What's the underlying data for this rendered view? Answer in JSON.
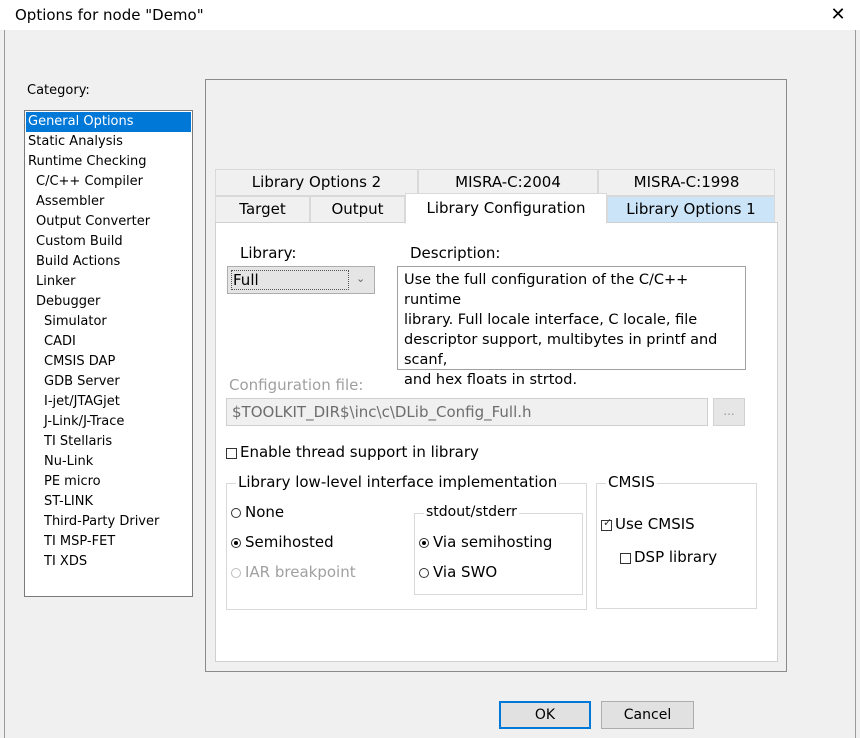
{
  "window": {
    "title": "Options for node \"Demo\""
  },
  "category": {
    "label": "Category:",
    "items": [
      {
        "label": "General Options",
        "selected": true
      },
      {
        "label": "Static Analysis"
      },
      {
        "label": "Runtime Checking"
      },
      {
        "label": "C/C++ Compiler"
      },
      {
        "label": "Assembler"
      },
      {
        "label": "Output Converter"
      },
      {
        "label": "Custom Build"
      },
      {
        "label": "Build Actions"
      },
      {
        "label": "Linker"
      },
      {
        "label": "Debugger"
      },
      {
        "label": "Simulator"
      },
      {
        "label": "CADI"
      },
      {
        "label": "CMSIS DAP"
      },
      {
        "label": "GDB Server"
      },
      {
        "label": "I-jet/JTAGjet"
      },
      {
        "label": "J-Link/J-Trace"
      },
      {
        "label": "TI Stellaris"
      },
      {
        "label": "Nu-Link"
      },
      {
        "label": "PE micro"
      },
      {
        "label": "ST-LINK"
      },
      {
        "label": "Third-Party Driver"
      },
      {
        "label": "TI MSP-FET"
      },
      {
        "label": "TI XDS"
      }
    ]
  },
  "tabs": {
    "row1": [
      "Library Options 2",
      "MISRA-C:2004",
      "MISRA-C:1998"
    ],
    "row2": [
      "Target",
      "Output",
      "Library Configuration",
      "Library Options 1"
    ],
    "active": "Library Configuration"
  },
  "library": {
    "label": "Library:",
    "value": "Full",
    "description_label": "Description:",
    "description_lines": [
      "Use the full configuration of the C/C++ runtime",
      "library. Full locale interface, C locale, file",
      "descriptor support, multibytes in printf and scanf,",
      "and hex floats in strtod."
    ]
  },
  "config_file": {
    "label": "Configuration file:",
    "value": "$TOOLKIT_DIR$\\inc\\c\\DLib_Config_Full.h",
    "browse_label": "..."
  },
  "thread_support": {
    "label": "Enable thread support in library",
    "checked": false
  },
  "low_level": {
    "title": "Library low-level interface implementation",
    "options": [
      "None",
      "Semihosted",
      "IAR breakpoint"
    ],
    "selected": "Semihosted"
  },
  "stdout": {
    "title": "stdout/stderr",
    "options": [
      "Via semihosting",
      "Via SWO"
    ],
    "selected": "Via semihosting"
  },
  "cmsis": {
    "title": "CMSIS",
    "use_cmsis": {
      "label": "Use CMSIS",
      "checked": true
    },
    "dsp_library": {
      "label": "DSP library",
      "checked": false
    }
  },
  "buttons": {
    "ok": "OK",
    "cancel": "Cancel"
  }
}
